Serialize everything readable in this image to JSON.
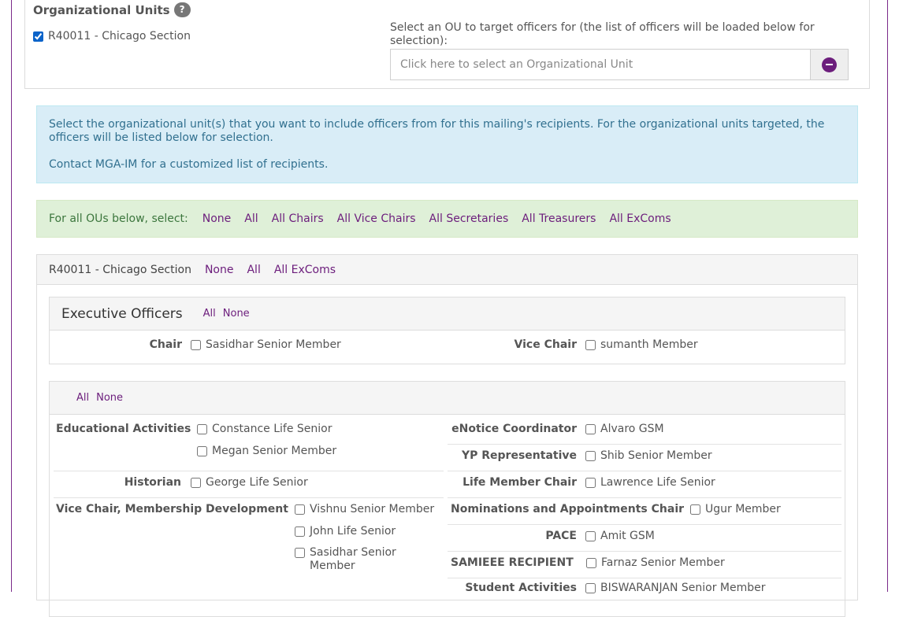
{
  "ou_section": {
    "title": "Organizational Units",
    "help_icon": "?",
    "selected_ou": "R40011 - Chicago Section",
    "select_label": "Select an OU to target officers for (the list of officers will be loaded below for selection):",
    "select_placeholder": "Click here to select an Organizational Unit"
  },
  "info": {
    "line1": "Select the organizational unit(s) that you want to include officers from for this mailing's recipients. For the organizational units targeted, the officers will be listed below for selection.",
    "line2": "Contact MGA-IM for a customized list of recipients."
  },
  "global_select": {
    "label": "For all OUs below, select:",
    "links": [
      "None",
      "All",
      "All Chairs",
      "All Vice Chairs",
      "All Secretaries",
      "All Treasurers",
      "All ExComs"
    ]
  },
  "unit": {
    "name": "R40011 - Chicago Section",
    "links": [
      "None",
      "All",
      "All ExComs"
    ],
    "executive": {
      "title": "Executive Officers",
      "all": "All",
      "none": "None",
      "chair_role": "Chair",
      "chair_person": "Sasidhar Senior Member",
      "vice_role": "Vice Chair",
      "vice_person": "sumanth Member"
    },
    "others": {
      "all": "All",
      "none": "None",
      "edu_role": "Educational Activities",
      "edu_p1": "Constance Life Senior",
      "edu_p2": "Megan Senior Member",
      "hist_role": "Historian",
      "hist_p1": "George Life Senior",
      "vcmd_role": "Vice Chair, Membership Development",
      "vcmd_p1": "Vishnu Senior Member",
      "vcmd_p2": "John Life Senior",
      "vcmd_p3": "Sasidhar Senior Member",
      "enotice_role": "eNotice Coordinator",
      "enotice_p1": "Alvaro GSM",
      "yp_role": "YP Representative",
      "yp_p1": "Shib Senior Member",
      "lmc_role": "Life Member Chair",
      "lmc_p1": "Lawrence Life Senior",
      "nac_role": "Nominations and Appointments Chair",
      "nac_p1": "Ugur Member",
      "pace_role": "PACE",
      "pace_p1": "Amit GSM",
      "sam_role": "SAMIEEE RECIPIENT",
      "sam_p1": "Farnaz Senior Member",
      "sa_role": "Student Activities",
      "sa_p1": "BISWARANJAN Senior Member"
    }
  }
}
